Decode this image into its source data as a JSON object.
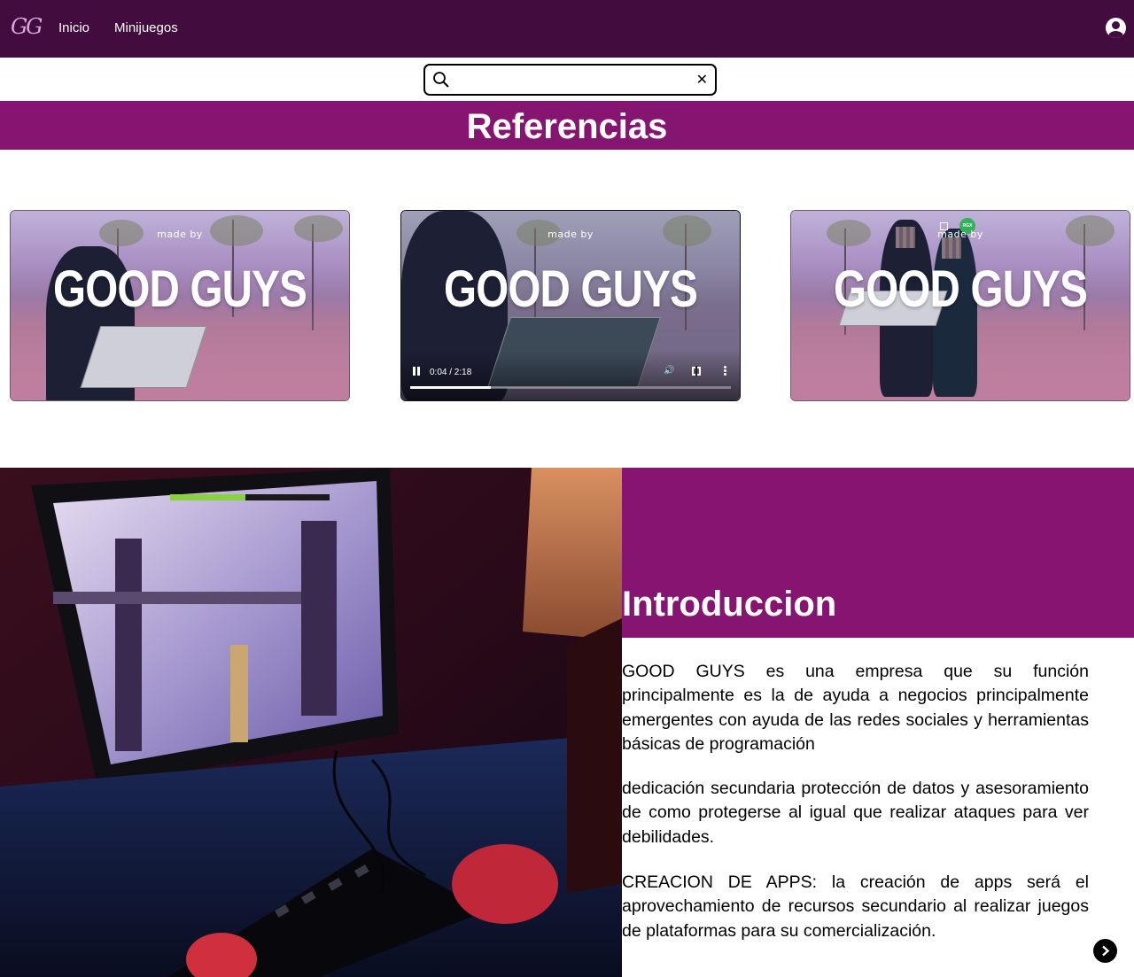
{
  "navbar": {
    "brand": "GG",
    "links": [
      {
        "label": "Inicio"
      },
      {
        "label": "Minijuegos"
      }
    ],
    "account_icon": "user-circle-icon",
    "background": "#420c3e"
  },
  "search": {
    "value": "",
    "placeholder": "",
    "search_icon": "search-icon",
    "clear_label": "✕"
  },
  "referencias": {
    "title": "Referencias",
    "background": "#861571"
  },
  "videos": [
    {
      "made_by": "made by",
      "title": "GOOD GUYS",
      "playing": false
    },
    {
      "made_by": "made by",
      "title": "GOOD GUYS",
      "playing": true,
      "time": "0:04 / 2:18",
      "progress": 0.25
    },
    {
      "made_by": "made by",
      "title": "GOOD GUYS",
      "playing": false,
      "badge": "RGX"
    }
  ],
  "intro": {
    "title": "Introduccion",
    "paragraphs": [
      "GOOD GUYS es una empresa que su función principalmente es la de ayuda a negocios principalmente emergentes con ayuda de las redes sociales y herramientas básicas de programación",
      "dedicación secundaria protección de datos y asesoramiento de como protegerse al igual que realizar ataques para ver debilidades.",
      "CREACION DE APPS: la creación de apps será el aprovechamiento de recursos secundario al realizar juegos de plataformas para su comercialización."
    ],
    "accent": "#861571",
    "next_icon": "chevron-right-icon"
  }
}
